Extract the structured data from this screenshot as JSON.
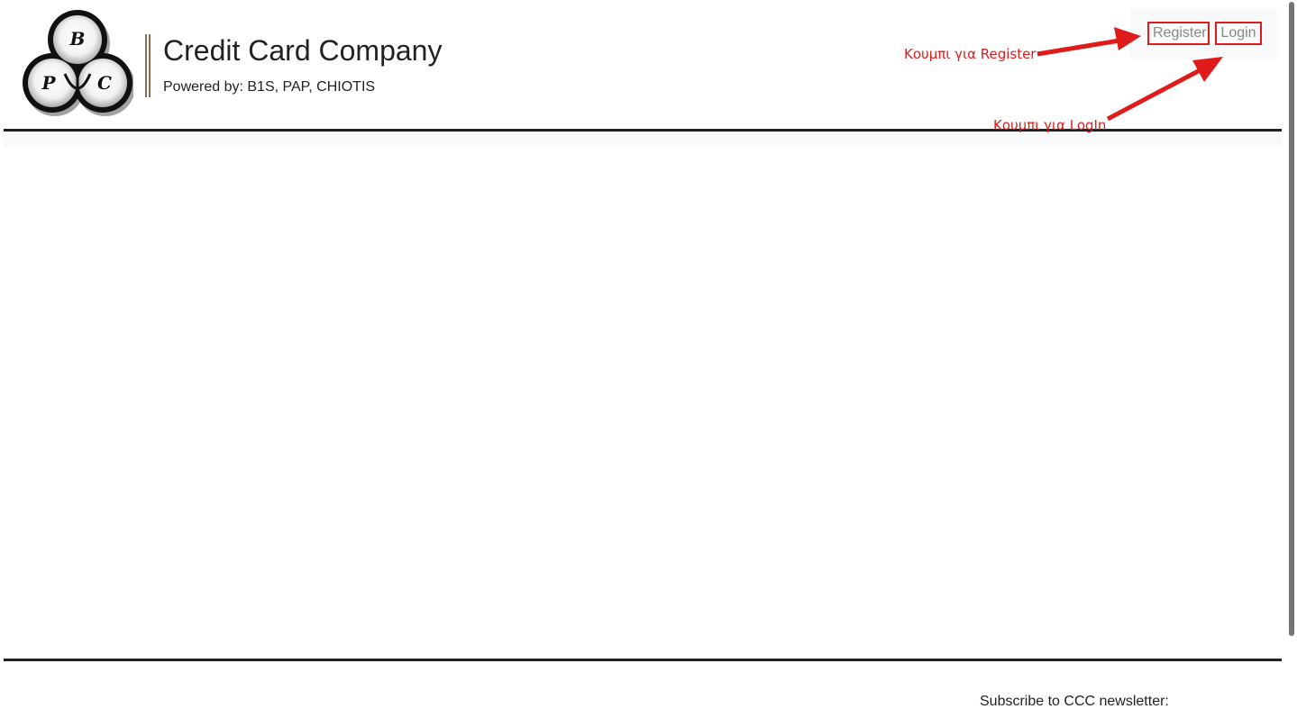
{
  "header": {
    "title": "Credit Card Company",
    "subtitle": "Powered by: B1S, PAP, CHIOTIS",
    "logo": {
      "letters": [
        "B",
        "P",
        "C"
      ]
    }
  },
  "auth": {
    "register_label": "Register",
    "login_label": "Login"
  },
  "annotations": {
    "register": "Κουμπι για Register",
    "login": "Κουμπι για LogIn"
  },
  "footer": {
    "newsletter_label": "Subscribe to CCC newsletter:"
  },
  "colors": {
    "annotation": "#e01b1b",
    "text": "#222222",
    "button_text": "#888888",
    "divider": "#8a6d57"
  }
}
